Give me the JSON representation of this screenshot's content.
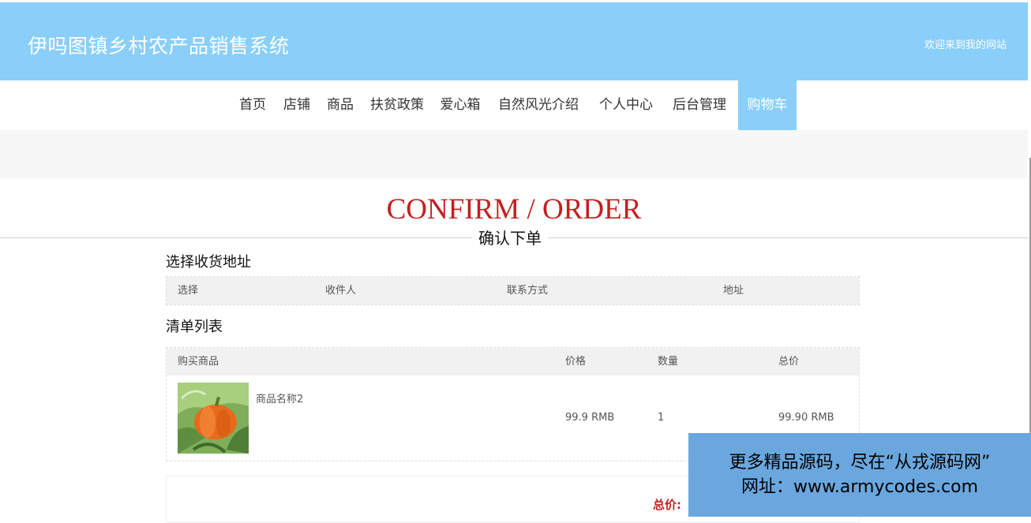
{
  "header": {
    "title": "伊吗图镇乡村农产品销售系统",
    "welcome": "欢迎来到我的网站"
  },
  "nav": {
    "items": [
      "首页",
      "店铺",
      "商品",
      "扶贫政策",
      "爱心箱",
      "自然风光介绍",
      "个人中心",
      "后台管理",
      "购物车"
    ],
    "active": "购物车"
  },
  "confirm": {
    "title": "CONFIRM / ORDER",
    "subtitle": "确认下单"
  },
  "address_section": {
    "heading": "选择收货地址",
    "columns": [
      "选择",
      "收件人",
      "联系方式",
      "地址"
    ]
  },
  "list_section": {
    "heading": "清单列表",
    "columns": [
      "购买商品",
      "价格",
      "数量",
      "总价"
    ],
    "rows": [
      {
        "name": "商品名称2",
        "price": "99.9 RMB",
        "quantity": "1",
        "total": "99.90 RMB",
        "image": "pumpkin-photo"
      }
    ]
  },
  "summary": {
    "total_label": "总价:"
  },
  "watermark": {
    "line1": "更多精品源码，尽在“从戎源码网”",
    "line2": "网址：www.armycodes.com"
  },
  "colors": {
    "accent": "#8acffa",
    "title_red": "#c3201f",
    "watermark_bg": "#6aa7de"
  }
}
